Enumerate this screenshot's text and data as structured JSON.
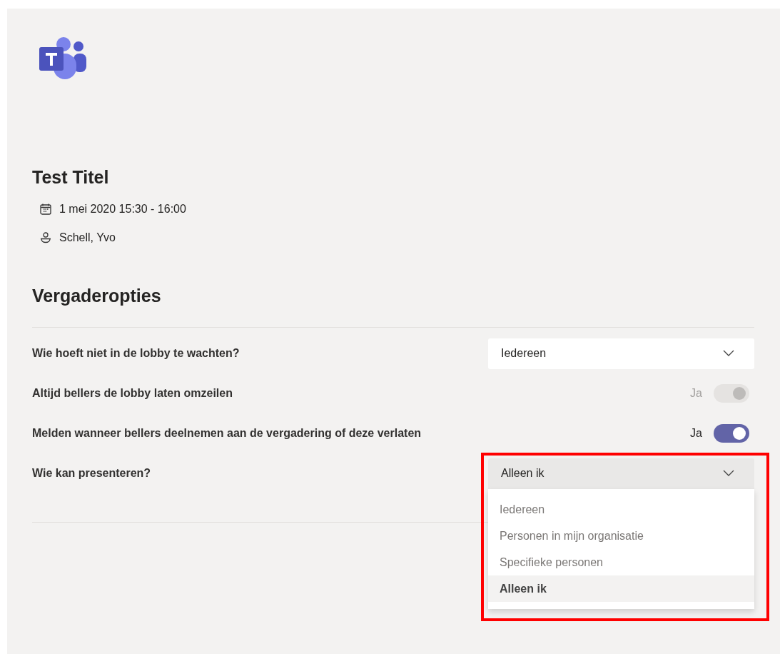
{
  "meeting": {
    "title": "Test Titel",
    "date": "1 mei 2020 15:30 - 16:00",
    "organizer": "Schell, Yvo"
  },
  "section_title": "Vergaderopties",
  "options": [
    {
      "kind": "dropdown",
      "label": "Wie hoeft niet in de lobby te wachten?",
      "value": "Iedereen",
      "expanded": false
    },
    {
      "kind": "toggle",
      "label": "Altijd bellers de lobby laten omzeilen",
      "state_label": "Ja",
      "on": true,
      "disabled": true
    },
    {
      "kind": "toggle",
      "label": "Melden wanneer bellers deelnemen aan de vergadering of deze verlaten",
      "state_label": "Ja",
      "on": true,
      "disabled": false
    },
    {
      "kind": "dropdown",
      "label": "Wie kan presenteren?",
      "value": "Alleen ik",
      "expanded": true,
      "choices": [
        {
          "label": "Iedereen",
          "selected": false
        },
        {
          "label": "Personen in mijn organisatie",
          "selected": false
        },
        {
          "label": "Specifieke personen",
          "selected": false
        },
        {
          "label": "Alleen ik",
          "selected": true
        }
      ]
    }
  ]
}
